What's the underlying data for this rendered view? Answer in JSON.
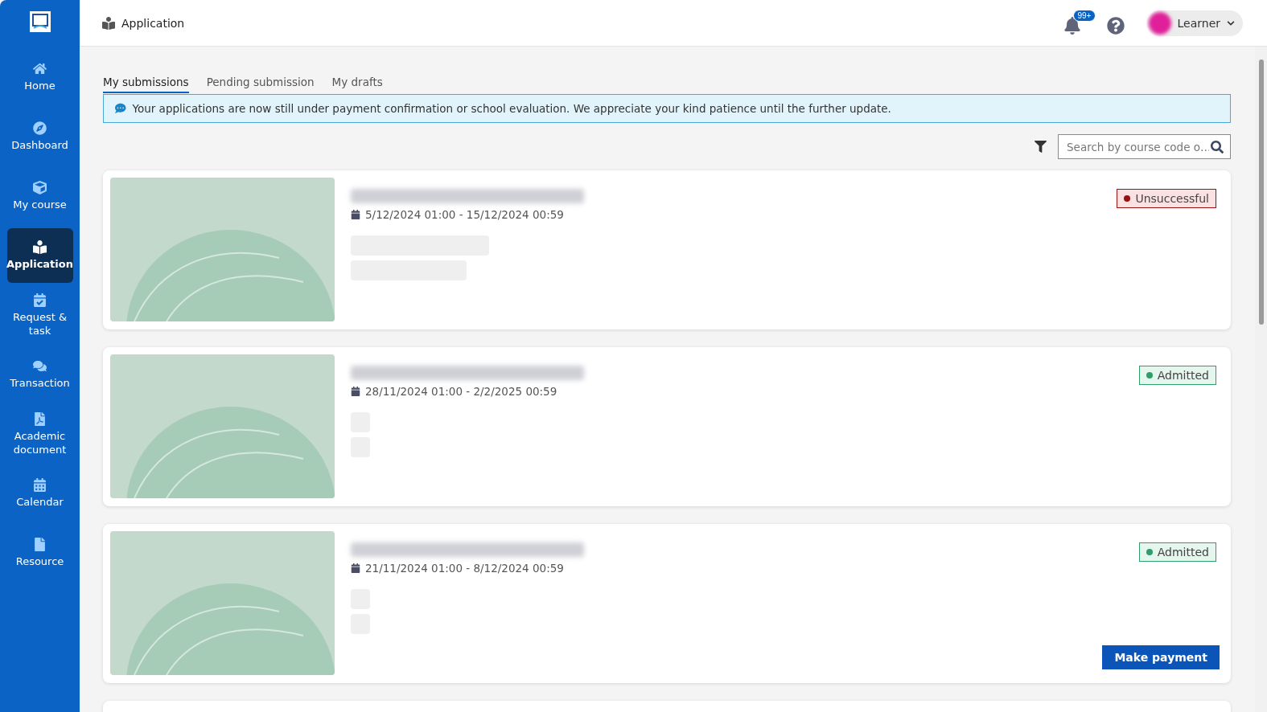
{
  "sidebar": {
    "items": [
      {
        "label": "Home",
        "selected": false
      },
      {
        "label": "Dashboard",
        "selected": false
      },
      {
        "label": "My course",
        "selected": false
      },
      {
        "label": "Application",
        "selected": true
      },
      {
        "label": "Request & task",
        "selected": false
      },
      {
        "label": "Transaction",
        "selected": false
      },
      {
        "label": "Academic document",
        "selected": false
      },
      {
        "label": "Calendar",
        "selected": false
      },
      {
        "label": "Resource",
        "selected": false
      }
    ]
  },
  "header": {
    "title": "Application",
    "notification_count": "99+",
    "user": "Learner"
  },
  "tabs": [
    {
      "label": "My submissions",
      "selected": true
    },
    {
      "label": "Pending submission",
      "selected": false
    },
    {
      "label": "My drafts",
      "selected": false
    }
  ],
  "notice": "Your applications are now still under payment confirmation or school evaluation. We appreciate your kind patience until the further update.",
  "search": {
    "placeholder": "Search by course code o…"
  },
  "applications": [
    {
      "dates": "5/12/2024 01:00 - 15/12/2024 00:59",
      "status": "Unsuccessful",
      "kind": "unsuccessful",
      "color": "#9b1010"
    },
    {
      "dates": "28/11/2024 01:00 - 2/2/2025 00:59",
      "status": "Admitted",
      "kind": "admitted",
      "color": "#2e9e6a"
    },
    {
      "dates": "21/11/2024 01:00 - 8/12/2024 00:59",
      "status": "Admitted",
      "kind": "admitted",
      "color": "#2e9e6a",
      "action": "Make payment"
    }
  ]
}
